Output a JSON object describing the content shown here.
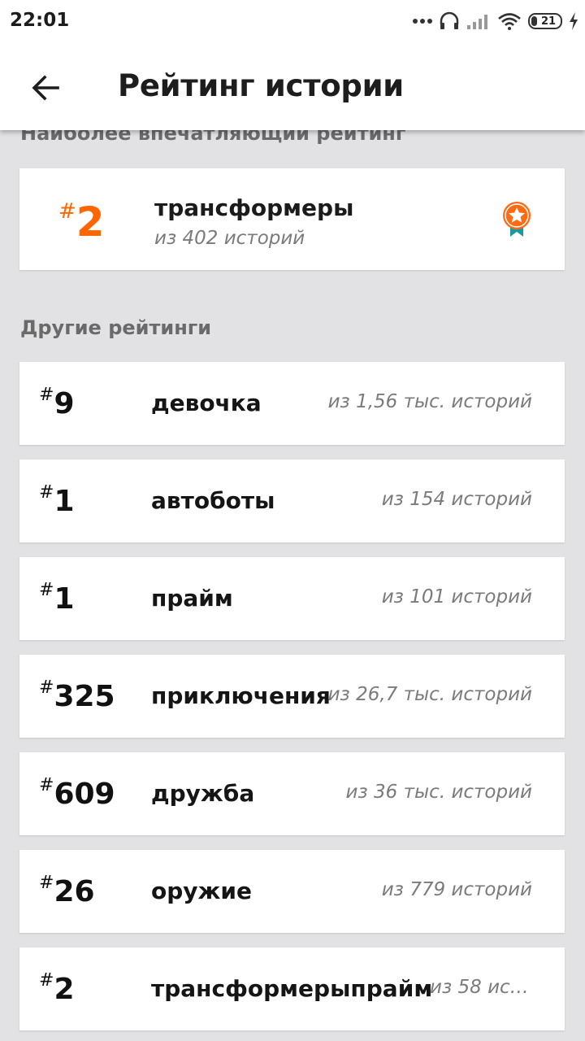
{
  "status_bar": {
    "time": "22:01",
    "battery_level": "21"
  },
  "header": {
    "title": "Рейтинг истории"
  },
  "featured": {
    "section_title": "Наиболее впечатляющий рейтинг",
    "hash": "#",
    "rank": "2",
    "tag": "трансформеры",
    "count": "из 402 историй",
    "accent_color": "#ff6600"
  },
  "others": {
    "section_title": "Другие рейтинги",
    "items": [
      {
        "hash": "#",
        "rank": "9",
        "tag": "девочка",
        "count": "из 1,56 тыс. историй"
      },
      {
        "hash": "#",
        "rank": "1",
        "tag": "автоботы",
        "count": "из 154 историй"
      },
      {
        "hash": "#",
        "rank": "1",
        "tag": "прайм",
        "count": "из 101 историй"
      },
      {
        "hash": "#",
        "rank": "325",
        "tag": "приключения",
        "count": "из 26,7 тыс. историй"
      },
      {
        "hash": "#",
        "rank": "609",
        "tag": "дружба",
        "count": "из 36 тыс. историй"
      },
      {
        "hash": "#",
        "rank": "26",
        "tag": "оружие",
        "count": "из 779 историй"
      },
      {
        "hash": "#",
        "rank": "2",
        "tag": "трансформерыпрайм",
        "count": "из 58 ист..."
      }
    ]
  }
}
